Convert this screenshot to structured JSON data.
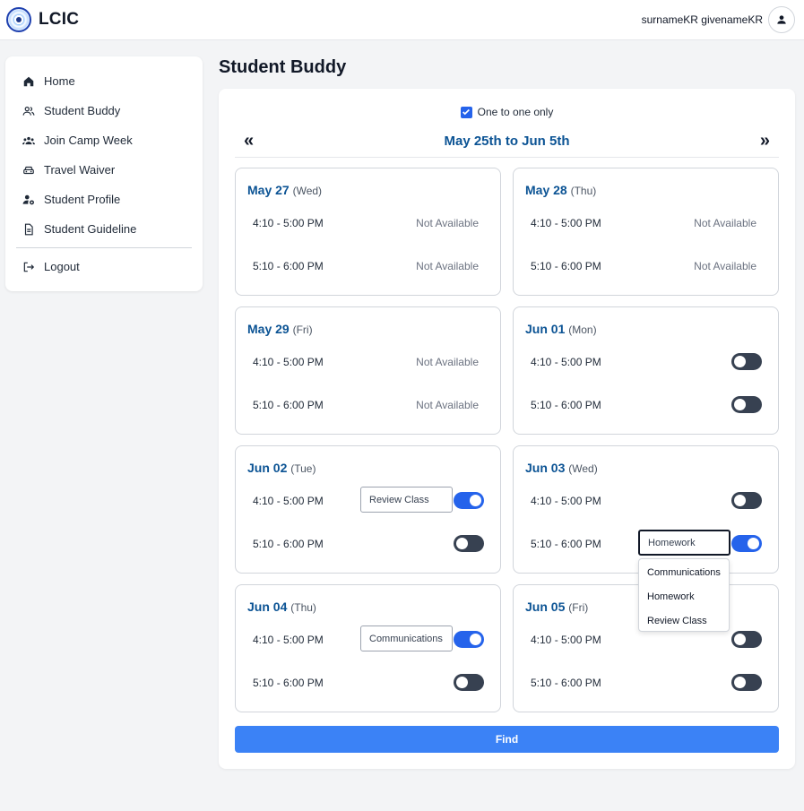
{
  "app": {
    "name": "LCIC"
  },
  "user": {
    "display_name": "surnameKR givenameKR"
  },
  "sidebar": {
    "items": [
      {
        "label": "Home",
        "icon": "home-icon"
      },
      {
        "label": "Student Buddy",
        "icon": "users-icon"
      },
      {
        "label": "Join Camp Week",
        "icon": "group-icon"
      },
      {
        "label": "Travel Waiver",
        "icon": "car-icon"
      },
      {
        "label": "Student Profile",
        "icon": "user-gear-icon"
      },
      {
        "label": "Student Guideline",
        "icon": "document-icon"
      }
    ],
    "logout": {
      "label": "Logout",
      "icon": "logout-icon"
    }
  },
  "page": {
    "title": "Student Buddy"
  },
  "filter": {
    "one_to_one_label": "One to one only",
    "one_to_one_checked": true
  },
  "range": {
    "label": "May 25th to Jun 5th",
    "prev": "«",
    "next": "»"
  },
  "days": [
    {
      "date": "May 27",
      "dow": "(Wed)",
      "slots": [
        {
          "time": "4:10 - 5:00 PM",
          "status": "Not Available"
        },
        {
          "time": "5:10 - 6:00 PM",
          "status": "Not Available"
        }
      ]
    },
    {
      "date": "May 28",
      "dow": "(Thu)",
      "slots": [
        {
          "time": "4:10 - 5:00 PM",
          "status": "Not Available"
        },
        {
          "time": "5:10 - 6:00 PM",
          "status": "Not Available"
        }
      ]
    },
    {
      "date": "May 29",
      "dow": "(Fri)",
      "slots": [
        {
          "time": "4:10 - 5:00 PM",
          "status": "Not Available"
        },
        {
          "time": "5:10 - 6:00 PM",
          "status": "Not Available"
        }
      ]
    },
    {
      "date": "Jun 01",
      "dow": "(Mon)",
      "slots": [
        {
          "time": "4:10 - 5:00 PM",
          "enabled": false
        },
        {
          "time": "5:10 - 6:00 PM",
          "enabled": false
        }
      ]
    },
    {
      "date": "Jun 02",
      "dow": "(Tue)",
      "slots": [
        {
          "time": "4:10 - 5:00 PM",
          "enabled": true,
          "topic": "Review Class"
        },
        {
          "time": "5:10 - 6:00 PM",
          "enabled": false
        }
      ]
    },
    {
      "date": "Jun 03",
      "dow": "(Wed)",
      "slots": [
        {
          "time": "4:10 - 5:00 PM",
          "enabled": false
        },
        {
          "time": "5:10 - 6:00 PM",
          "enabled": true,
          "topic": "Homework"
        }
      ]
    },
    {
      "date": "Jun 04",
      "dow": "(Thu)",
      "slots": [
        {
          "time": "4:10 - 5:00 PM",
          "enabled": true,
          "topic": "Communications"
        },
        {
          "time": "5:10 - 6:00 PM",
          "enabled": false
        }
      ]
    },
    {
      "date": "Jun 05",
      "dow": "(Fri)",
      "slots": [
        {
          "time": "4:10 - 5:00 PM",
          "enabled": false
        },
        {
          "time": "5:10 - 6:00 PM",
          "enabled": false
        }
      ]
    }
  ],
  "dropdown": {
    "options": [
      "Communications",
      "Homework",
      "Review Class"
    ]
  },
  "actions": {
    "find_label": "Find"
  },
  "colors": {
    "accent": "#2563eb",
    "date_blue": "#0b5394",
    "find_button": "#3b82f6",
    "toggle_off": "#374151"
  }
}
